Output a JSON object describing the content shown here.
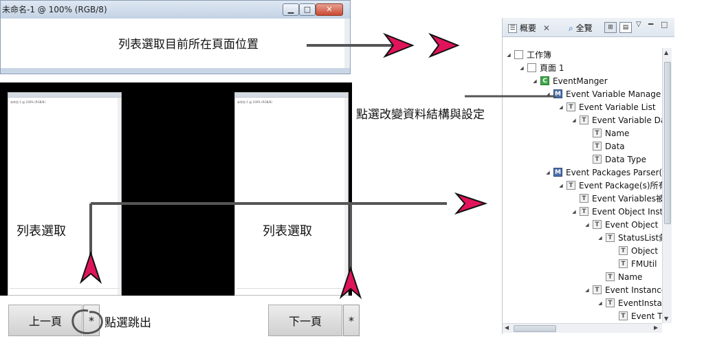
{
  "window": {
    "title": "未命名-1 @ 100% (RGB/8)",
    "minimize": "▁",
    "restore": "□",
    "close": "✕"
  },
  "callouts": {
    "top": "列表選取目前所在頁面位置",
    "change": "點選改變資料結構與設定",
    "popout": "點選跳出"
  },
  "thumbnails": [
    {
      "label": "列表選取"
    },
    {
      "label": "列表選取"
    }
  ],
  "nav": {
    "prev": "上一頁",
    "next": "下一頁",
    "star": "*"
  },
  "outline": {
    "tab_outline": "概要",
    "tab_overview": "全覽",
    "tree": [
      {
        "depth": 0,
        "toggle": "◢",
        "icon": "box",
        "icon_text": "",
        "label": "工作簿"
      },
      {
        "depth": 1,
        "toggle": "◢",
        "icon": "box",
        "icon_text": "",
        "label": "頁面 1"
      },
      {
        "depth": 2,
        "toggle": "◢",
        "icon": "C",
        "icon_text": "C",
        "label": "EventManger"
      },
      {
        "depth": 3,
        "toggle": "◢",
        "icon": "M",
        "icon_text": "M",
        "label": "Event Variable Manage"
      },
      {
        "depth": 4,
        "toggle": "◢",
        "icon": "T",
        "icon_text": "T",
        "label": "Event Variable List"
      },
      {
        "depth": 5,
        "toggle": "◢",
        "icon": "T",
        "icon_text": "T",
        "label": "Event Variable Da"
      },
      {
        "depth": 6,
        "toggle": "",
        "icon": "T",
        "icon_text": "T",
        "label": "Name"
      },
      {
        "depth": 6,
        "toggle": "",
        "icon": "T",
        "icon_text": "T",
        "label": "Data"
      },
      {
        "depth": 6,
        "toggle": "",
        "icon": "T",
        "icon_text": "T",
        "label": "Data Type"
      },
      {
        "depth": 3,
        "toggle": "◢",
        "icon": "M",
        "icon_text": "M",
        "label": "Event Packages Parser(記"
      },
      {
        "depth": 4,
        "toggle": "◢",
        "icon": "T",
        "icon_text": "T",
        "label": "Event Package(s)所有"
      },
      {
        "depth": 5,
        "toggle": "",
        "icon": "T",
        "icon_text": "T",
        "label": "Event Variables被"
      },
      {
        "depth": 5,
        "toggle": "◢",
        "icon": "T",
        "icon_text": "T",
        "label": "Event Object Inst"
      },
      {
        "depth": 6,
        "toggle": "◢",
        "icon": "T",
        "icon_text": "T",
        "label": "Event Object"
      },
      {
        "depth": 7,
        "toggle": "◢",
        "icon": "T",
        "icon_text": "T",
        "label": "StatusList彙"
      },
      {
        "depth": 8,
        "toggle": "",
        "icon": "T",
        "icon_text": "T",
        "label": "Object"
      },
      {
        "depth": 8,
        "toggle": "",
        "icon": "T",
        "icon_text": "T",
        "label": "FMUtil"
      },
      {
        "depth": 7,
        "toggle": "",
        "icon": "T",
        "icon_text": "T",
        "label": "Name"
      },
      {
        "depth": 6,
        "toggle": "◢",
        "icon": "T",
        "icon_text": "T",
        "label": "Event Instance"
      },
      {
        "depth": 7,
        "toggle": "◢",
        "icon": "T",
        "icon_text": "T",
        "label": "EventInsta"
      },
      {
        "depth": 8,
        "toggle": "",
        "icon": "T",
        "icon_text": "T",
        "label": "Event T"
      }
    ]
  },
  "colors": {
    "arrow": "#e0145a",
    "arrow_outline": "#111111",
    "connector": "#555555"
  }
}
